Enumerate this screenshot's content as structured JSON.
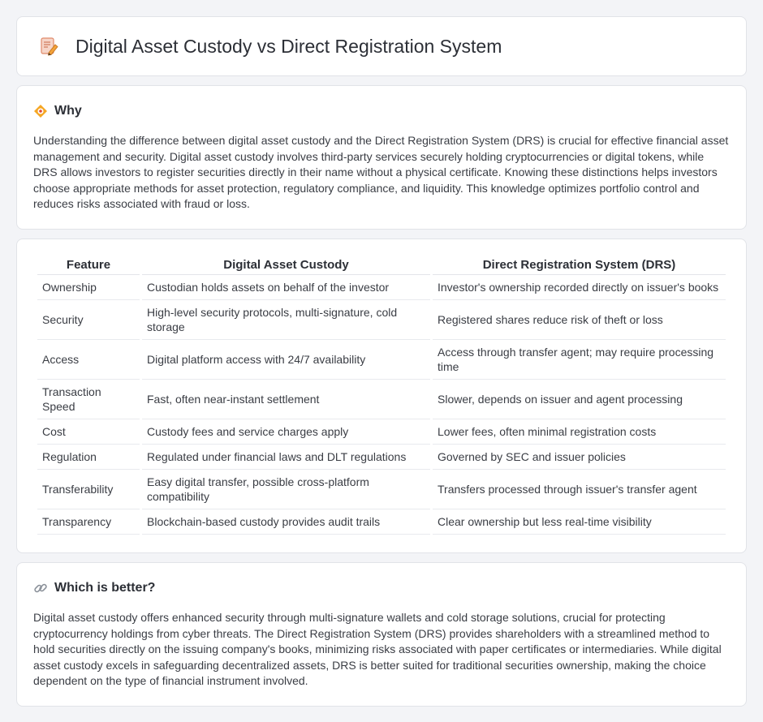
{
  "header": {
    "title": "Digital Asset Custody vs Direct Registration System",
    "icon": "document-pencil-icon"
  },
  "why": {
    "title": "Why",
    "icon": "target-diamond-icon",
    "text": "Understanding the difference between digital asset custody and the Direct Registration System (DRS) is crucial for effective financial asset management and security. Digital asset custody involves third-party services securely holding cryptocurrencies or digital tokens, while DRS allows investors to register securities directly in their name without a physical certificate. Knowing these distinctions helps investors choose appropriate methods for asset protection, regulatory compliance, and liquidity. This knowledge optimizes portfolio control and reduces risks associated with fraud or loss."
  },
  "table": {
    "headers": [
      "Feature",
      "Digital Asset Custody",
      "Direct Registration System (DRS)"
    ],
    "rows": [
      [
        "Ownership",
        "Custodian holds assets on behalf of the investor",
        "Investor's ownership recorded directly on issuer's books"
      ],
      [
        "Security",
        "High-level security protocols, multi-signature, cold storage",
        "Registered shares reduce risk of theft or loss"
      ],
      [
        "Access",
        "Digital platform access with 24/7 availability",
        "Access through transfer agent; may require processing time"
      ],
      [
        "Transaction Speed",
        "Fast, often near-instant settlement",
        "Slower, depends on issuer and agent processing"
      ],
      [
        "Cost",
        "Custody fees and service charges apply",
        "Lower fees, often minimal registration costs"
      ],
      [
        "Regulation",
        "Regulated under financial laws and DLT regulations",
        "Governed by SEC and issuer policies"
      ],
      [
        "Transferability",
        "Easy digital transfer, possible cross-platform compatibility",
        "Transfers processed through issuer's transfer agent"
      ],
      [
        "Transparency",
        "Blockchain-based custody provides audit trails",
        "Clear ownership but less real-time visibility"
      ]
    ]
  },
  "better": {
    "title": "Which is better?",
    "icon": "link-icon",
    "text": "Digital asset custody offers enhanced security through multi-signature wallets and cold storage solutions, crucial for protecting cryptocurrency holdings from cyber threats. The Direct Registration System (DRS) provides shareholders with a streamlined method to hold securities directly on the issuing company's books, minimizing risks associated with paper certificates or intermediaries. While digital asset custody excels in safeguarding decentralized assets, DRS is better suited for traditional securities ownership, making the choice dependent on the type of financial instrument involved."
  }
}
